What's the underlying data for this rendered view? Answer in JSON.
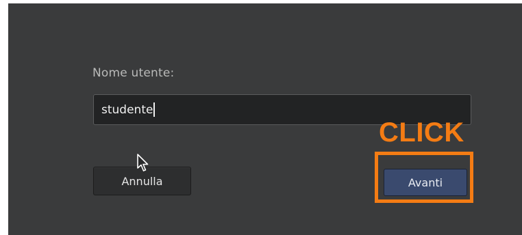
{
  "login": {
    "username_label": "Nome utente:",
    "username_value": "studente",
    "cancel_label": "Annulla",
    "next_label": "Avanti"
  },
  "annotation": {
    "click_text": "CLICK",
    "color": "#f47c14"
  },
  "icons": {
    "cursor": "mouse-pointer-icon"
  },
  "colors": {
    "dialog_background": "#3a3b3c",
    "input_background": "#222324",
    "primary_button": "#3a4a6e"
  }
}
